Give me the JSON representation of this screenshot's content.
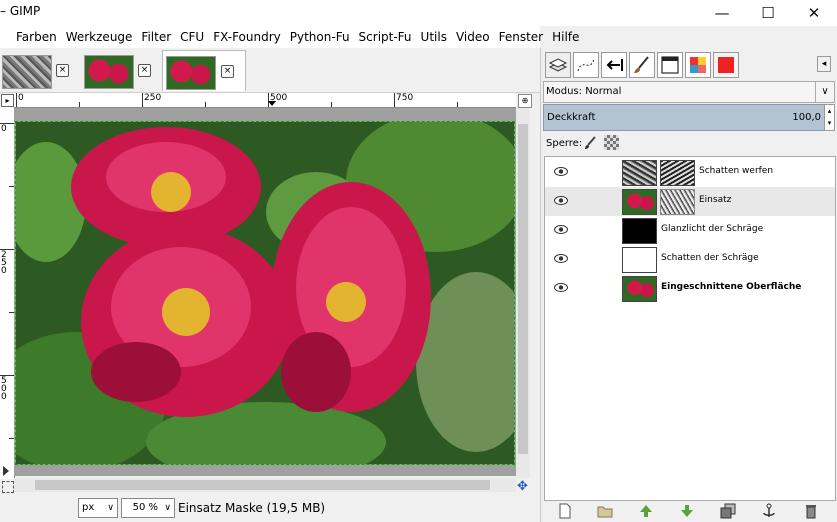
{
  "window": {
    "title": "– GIMP",
    "minimize_glyph": "—",
    "maximize_glyph": "☐",
    "close_glyph": "✕"
  },
  "menu": [
    "Farben",
    "Werkzeuge",
    "Filter",
    "CFU",
    "FX-Foundry",
    "Python-Fu",
    "Script-Fu",
    "Utils",
    "Video",
    "Fenster",
    "Hilfe"
  ],
  "image_tabs": [
    {
      "name": "grayscale-texture",
      "close": "×"
    },
    {
      "name": "peony-flowers",
      "close": "×"
    },
    {
      "name": "peony-flowers-active",
      "close": "×"
    }
  ],
  "rulers": {
    "h_labels": [
      "0",
      "250",
      "500",
      "750"
    ],
    "v_labels": [
      "0",
      "250",
      "500"
    ]
  },
  "status": {
    "unit": "px",
    "zoom": "50 %",
    "info": "Einsatz Maske (19,5 MB)"
  },
  "dock": {
    "mode_label": "Modus: Normal",
    "opacity_label": "Deckkraft",
    "opacity_value": "100,0",
    "lock_label": "Sperre:",
    "layers": [
      {
        "name": "Schatten werfen",
        "bold": false,
        "selected": false
      },
      {
        "name": "Einsatz",
        "bold": false,
        "selected": true
      },
      {
        "name": "Glanzlicht der Schräge",
        "bold": false,
        "selected": false
      },
      {
        "name": "Schatten der Schräge",
        "bold": false,
        "selected": false
      },
      {
        "name": "Eingeschnittene Oberfläche",
        "bold": true,
        "selected": false
      }
    ]
  },
  "colors": {
    "opacity_bar": "#b3c3d1",
    "selection_outline": "#00aa00"
  }
}
